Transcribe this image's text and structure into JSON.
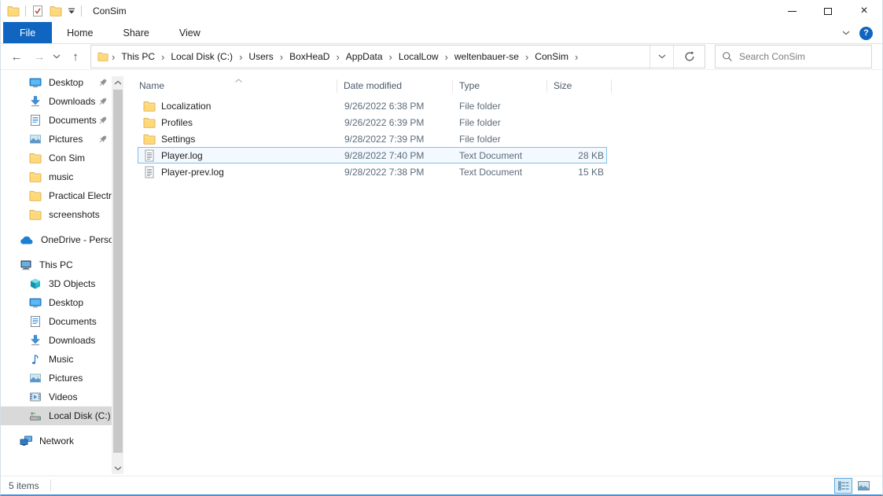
{
  "titlebar": {
    "title": "ConSim",
    "quick_access_icons": [
      "folder-icon",
      "properties-check-icon",
      "new-folder-icon",
      "customize-qat-chevron-icon"
    ]
  },
  "ribbon": {
    "tabs": [
      {
        "label": "File",
        "active": true
      },
      {
        "label": "Home",
        "active": false
      },
      {
        "label": "Share",
        "active": false
      },
      {
        "label": "View",
        "active": false
      }
    ],
    "help_label": "?"
  },
  "navbar": {
    "breadcrumb": {
      "segments": [
        "This PC",
        "Local Disk (C:)",
        "Users",
        "BoxHeaD",
        "AppData",
        "LocalLow",
        "weltenbauer-se",
        "ConSim"
      ]
    },
    "search": {
      "placeholder": "Search ConSim"
    }
  },
  "sidebar": {
    "items": [
      {
        "label": "Desktop",
        "icon": "desktop",
        "indent": 2,
        "pinned": true
      },
      {
        "label": "Downloads",
        "icon": "downloads",
        "indent": 2,
        "pinned": true
      },
      {
        "label": "Documents",
        "icon": "documents",
        "indent": 2,
        "pinned": true
      },
      {
        "label": "Pictures",
        "icon": "pictures",
        "indent": 2,
        "pinned": true
      },
      {
        "label": "Con Sim",
        "icon": "folder",
        "indent": 2
      },
      {
        "label": "music",
        "icon": "folder",
        "indent": 2
      },
      {
        "label": "Practical Electronics",
        "icon": "folder",
        "indent": 2
      },
      {
        "label": "screenshots",
        "icon": "folder",
        "indent": 2
      },
      {
        "label": "OneDrive - Personal",
        "icon": "onedrive",
        "indent": 1,
        "gap": true
      },
      {
        "label": "This PC",
        "icon": "thispc",
        "indent": 1,
        "gap": true
      },
      {
        "label": "3D Objects",
        "icon": "cube",
        "indent": 2
      },
      {
        "label": "Desktop",
        "icon": "desktop",
        "indent": 2
      },
      {
        "label": "Documents",
        "icon": "documents",
        "indent": 2
      },
      {
        "label": "Downloads",
        "icon": "downloads",
        "indent": 2
      },
      {
        "label": "Music",
        "icon": "music",
        "indent": 2
      },
      {
        "label": "Pictures",
        "icon": "pictures",
        "indent": 2
      },
      {
        "label": "Videos",
        "icon": "videos",
        "indent": 2
      },
      {
        "label": "Local Disk (C:)",
        "icon": "disk",
        "indent": 2,
        "selected": true
      },
      {
        "label": "Network",
        "icon": "network",
        "indent": 1,
        "gap": true
      }
    ]
  },
  "filelist": {
    "columns": [
      {
        "label": "Name",
        "sorted": "asc"
      },
      {
        "label": "Date modified"
      },
      {
        "label": "Type"
      },
      {
        "label": "Size"
      }
    ],
    "rows": [
      {
        "name": "Localization",
        "icon": "folder",
        "date": "9/26/2022 6:38 PM",
        "type": "File folder",
        "size": ""
      },
      {
        "name": "Profiles",
        "icon": "folder",
        "date": "9/26/2022 6:39 PM",
        "type": "File folder",
        "size": ""
      },
      {
        "name": "Settings",
        "icon": "folder",
        "date": "9/28/2022 7:39 PM",
        "type": "File folder",
        "size": ""
      },
      {
        "name": "Player.log",
        "icon": "textdoc",
        "date": "9/28/2022 7:40 PM",
        "type": "Text Document",
        "size": "28 KB",
        "selected": true
      },
      {
        "name": "Player-prev.log",
        "icon": "textdoc",
        "date": "9/28/2022 7:38 PM",
        "type": "Text Document",
        "size": "15 KB"
      }
    ]
  },
  "statusbar": {
    "items_count": "5 items",
    "view_buttons": [
      "details-view",
      "large-thumbnails-view"
    ]
  },
  "colors": {
    "accent_blue": "#1065c0",
    "selection_border": "#7cc1ee",
    "folder_yellow": "#ffd978",
    "active_view_bg": "#d6ebf8",
    "active_view_border": "#5fa8dc",
    "sidebar_selected_bg": "#d9d9d9"
  }
}
